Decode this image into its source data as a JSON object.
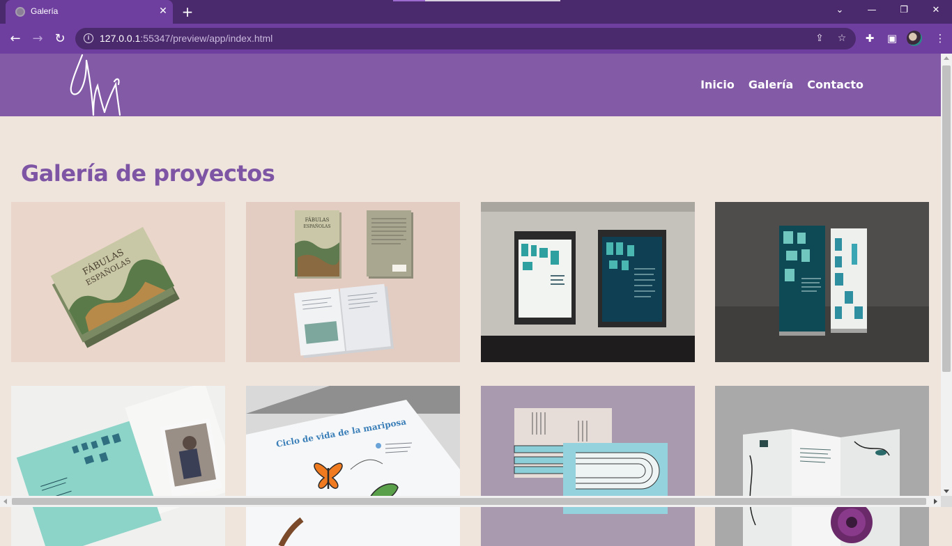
{
  "browser": {
    "tab_title": "Galería",
    "tab_close_icon": "close-icon",
    "new_tab_icon": "plus-icon",
    "url_host": "127.0.0.1",
    "url_rest": ":55347/preview/app/index.html",
    "window_controls": [
      "chevron-down-icon",
      "minimize-icon",
      "restore-icon",
      "close-icon"
    ],
    "theme_color": "#6f3fa0"
  },
  "site": {
    "header_color": "#835aa6",
    "logo_name": "AM monogram logo",
    "nav": {
      "inicio": "Inicio",
      "galeria": "Galería",
      "contacto": "Contacto"
    }
  },
  "gallery": {
    "title": "Galería de proyectos",
    "title_color": "#7d55a4",
    "items": [
      {
        "subject": "Fábulas Españolas book stack mockup",
        "thumb_text": [
          "FÁBULAS",
          "ESPAÑOLAS"
        ]
      },
      {
        "subject": "Fábulas Españolas book covers and spread",
        "thumb_text": [
          "FÁBULAS",
          "ESPAÑOLAS"
        ]
      },
      {
        "subject": "Julio Le Parc framed posters",
        "thumb_text": []
      },
      {
        "subject": "Julio Le Parc roll-up banners",
        "thumb_text": []
      },
      {
        "subject": "Julio Le Parc brochure",
        "thumb_text": []
      },
      {
        "subject": "Butterfly life cycle infographic",
        "thumb_text": [
          "Ciclo de vida de la mariposa"
        ]
      },
      {
        "subject": "Stationery set on lilac background",
        "thumb_text": []
      },
      {
        "subject": "Folded botanical brochure",
        "thumb_text": []
      }
    ]
  }
}
